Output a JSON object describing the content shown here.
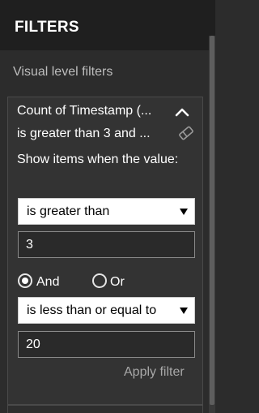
{
  "header": {
    "title": "FILTERS"
  },
  "section": {
    "label": "Visual level filters"
  },
  "filter_card": {
    "field_name": "Count of Timestamp (...",
    "condition_summary": "is greater than 3 and ...",
    "show_items_text": "Show items when the value:",
    "condition1": {
      "operator": "is greater than",
      "value": "3"
    },
    "logic": {
      "and_label": "And",
      "or_label": "Or",
      "selected": "And"
    },
    "condition2": {
      "operator": "is less than or equal to",
      "value": "20"
    },
    "apply_label": "Apply filter"
  },
  "icons": {
    "collapse": "chevron-up-icon",
    "clear": "eraser-icon",
    "dropdown": "triangle-down-icon"
  },
  "colors": {
    "header_bg": "#1f1f1f",
    "pane_bg": "#2c2c2c",
    "card_bg": "#333333"
  }
}
